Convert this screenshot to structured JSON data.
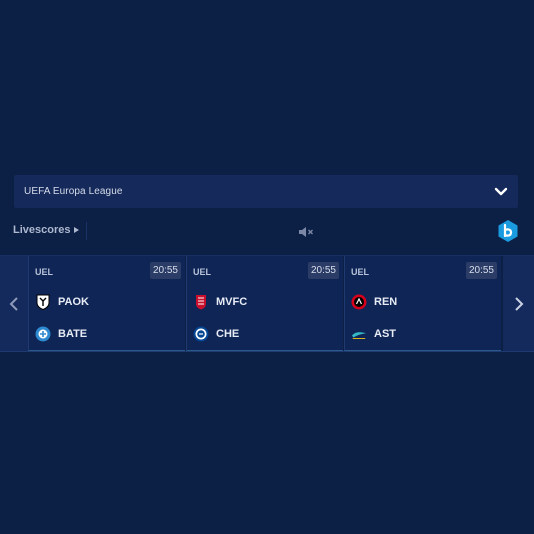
{
  "league_select": {
    "label": "UEFA Europa League",
    "icon": "chevron-down-icon"
  },
  "toolbar": {
    "livescores_label": "Livescores",
    "mute_icon": "speaker-mute-icon",
    "brand_icon": "brand-b-logo"
  },
  "matches": [
    {
      "competition": "UEL",
      "time": "20:55",
      "home": "PAOK",
      "away": "BATE"
    },
    {
      "competition": "UEL",
      "time": "20:55",
      "home": "MVFC",
      "away": "CHE"
    },
    {
      "competition": "UEL",
      "time": "20:55",
      "home": "REN",
      "away": "AST"
    }
  ],
  "colors": {
    "background": "#0c1f45",
    "accent": "#1a9be0",
    "card": "#0f2555"
  }
}
